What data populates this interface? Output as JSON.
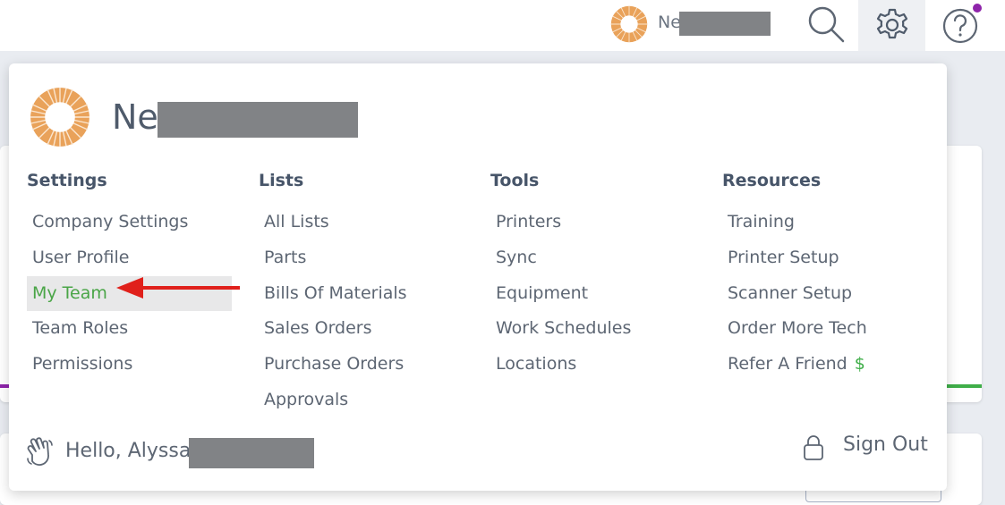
{
  "topbar": {
    "user_name_partial": "Ne",
    "icons": [
      "company-logo-icon",
      "search-icon",
      "gear-icon",
      "help-icon"
    ],
    "notification_dot_color": "#8e24aa"
  },
  "menu": {
    "user_name_partial": "Ne",
    "columns": [
      {
        "heading": "Settings",
        "items": [
          "Company Settings",
          "User Profile",
          "My Team",
          "Team Roles",
          "Permissions"
        ]
      },
      {
        "heading": "Lists",
        "items": [
          "All Lists",
          "Parts",
          "Bills Of Materials",
          "Sales Orders",
          "Purchase Orders",
          "Approvals"
        ]
      },
      {
        "heading": "Tools",
        "items": [
          "Printers",
          "Sync",
          "Equipment",
          "Work Schedules",
          "Locations"
        ]
      },
      {
        "heading": "Resources",
        "items": [
          "Training",
          "Printer Setup",
          "Scanner Setup",
          "Order More Tech",
          "Refer A Friend"
        ]
      }
    ],
    "active_item": "My Team",
    "refer_symbol": "$",
    "greeting": "Hello, Alyssa",
    "sign_out": "Sign Out"
  },
  "colors": {
    "active_text": "#4aa547",
    "active_bg": "#e8e8e9",
    "arrow": "#e0201b",
    "heading": "#475569"
  }
}
